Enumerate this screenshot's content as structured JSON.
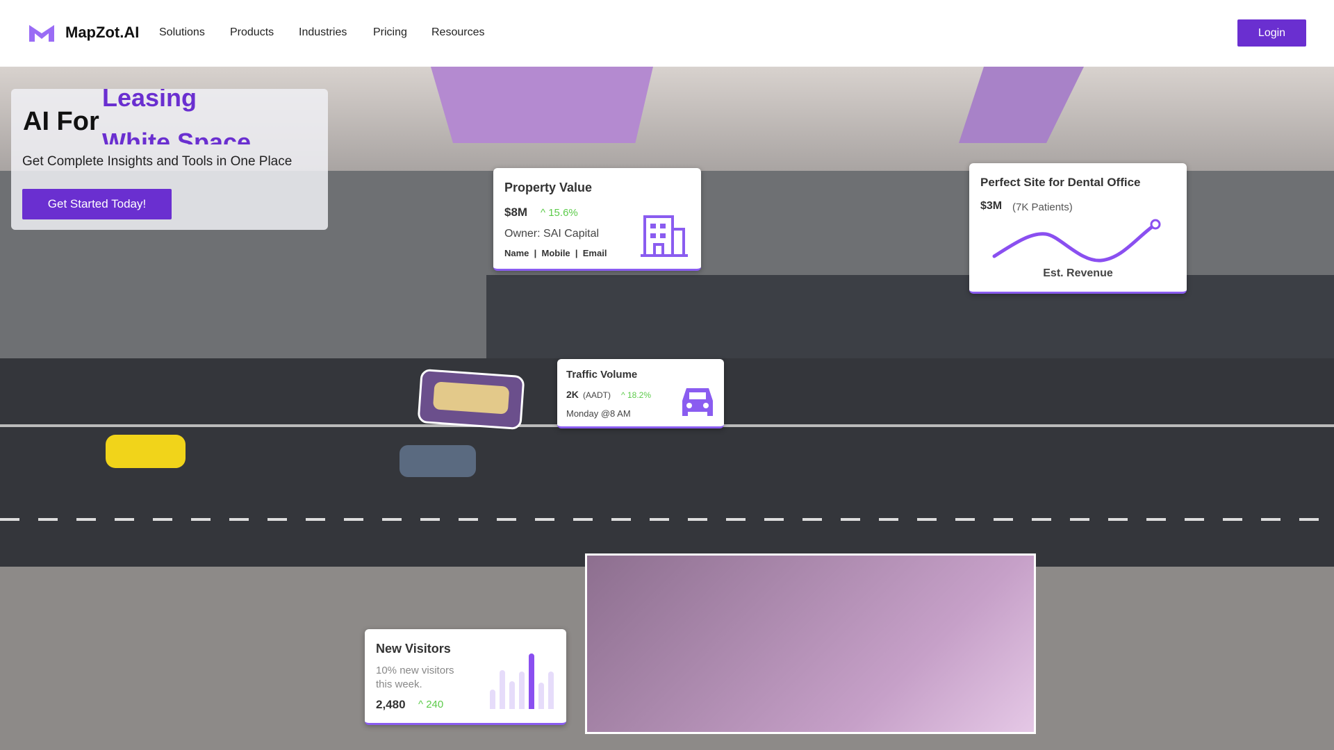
{
  "nav": {
    "brand": "MapZot.AI",
    "items": [
      "Solutions",
      "Products",
      "Industries",
      "Pricing",
      "Resources"
    ],
    "login": "Login"
  },
  "hero": {
    "prefix": "AI For",
    "rotating_top": "Leasing",
    "rotating_bottom": "White Space",
    "subtitle": "Get Complete Insights and Tools in One Place",
    "cta": "Get Started Today!"
  },
  "property": {
    "title": "Property Value",
    "value": "$8M",
    "change": "15.6%",
    "owner": "Owner: SAI Capital",
    "contacts": "Name  |  Mobile  |  Email",
    "icon": "building-icon"
  },
  "dental": {
    "title": "Perfect Site for Dental Office",
    "value": "$3M",
    "patients": "(7K Patients)",
    "chart_label": "Est. Revenue"
  },
  "traffic": {
    "title": "Traffic Volume",
    "value": "2K",
    "unit": "(AADT)",
    "change": "18.2%",
    "time": "Monday @8 AM",
    "icon": "car-icon"
  },
  "visitors": {
    "title": "New Visitors",
    "desc": "10% new visitors this week.",
    "value": "2,480",
    "change": "240",
    "bars": [
      0.35,
      0.7,
      0.5,
      0.68,
      1.0,
      0.48,
      0.68
    ],
    "highlight_index": 4
  },
  "colors": {
    "accent": "#6a2fd0",
    "purple_light": "#8a5cf0",
    "positive": "#5ccb4a"
  }
}
